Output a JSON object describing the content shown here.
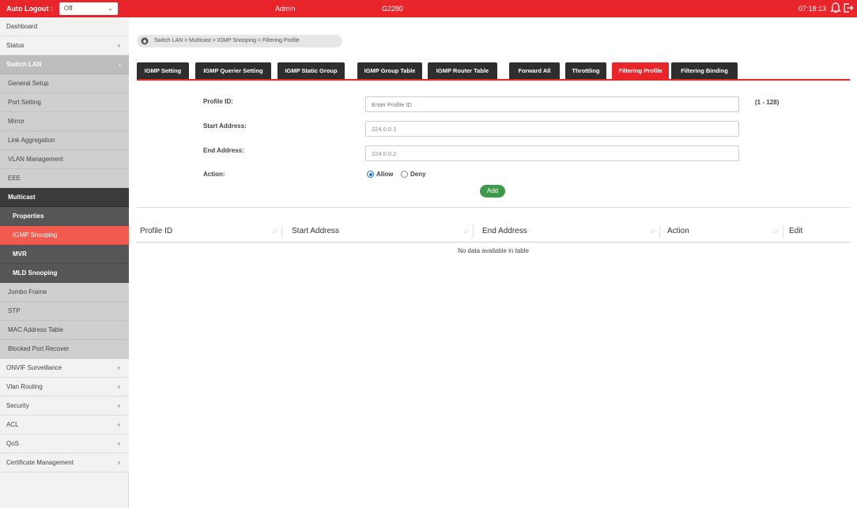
{
  "topbar": {
    "logout_label": "Auto Logout :",
    "logout_value": "Off",
    "user": "Admin",
    "model": "G2280",
    "clock": "07:18:13",
    "bell_icon": "bell-icon",
    "logout_icon": "logout-icon",
    "accent": "#e8252b"
  },
  "sidebar": {
    "items": [
      {
        "label": "Dashboard"
      },
      {
        "label": "Status",
        "sign": "+"
      },
      {
        "label": "Switch LAN",
        "sign": "-"
      },
      {
        "label": "General Setup"
      },
      {
        "label": "Port Setting"
      },
      {
        "label": "Mirror"
      },
      {
        "label": "Link Aggregation"
      },
      {
        "label": "VLAN Management"
      },
      {
        "label": "EEE"
      },
      {
        "label": "Multicast"
      },
      {
        "label": "Properties"
      },
      {
        "label": "IGMP Snooping"
      },
      {
        "label": "MVR"
      },
      {
        "label": "MLD Snooping"
      },
      {
        "label": "Jumbo Frame"
      },
      {
        "label": "STP"
      },
      {
        "label": "MAC Address Table"
      },
      {
        "label": "Blocked Port Recover"
      },
      {
        "label": "ONVIF Surveillance",
        "sign": "+"
      },
      {
        "label": "Vlan Routing",
        "sign": "+"
      },
      {
        "label": "Security",
        "sign": "+"
      },
      {
        "label": "ACL",
        "sign": "+"
      },
      {
        "label": "QoS",
        "sign": "+"
      },
      {
        "label": "Certificate Management",
        "sign": "+"
      }
    ]
  },
  "breadcrumb": "Switch LAN > Multicast > IGMP Snooping > Filtering Profile",
  "tabs": [
    {
      "label": "IGMP Setting"
    },
    {
      "label": "IGMP Querier Setting"
    },
    {
      "label": "IGMP Static Group"
    },
    {
      "label": "IGMP Group Table"
    },
    {
      "label": "IGMP Router Table"
    },
    {
      "label": "Forward All"
    },
    {
      "label": "Throttling"
    },
    {
      "label": "Filtering Profile"
    },
    {
      "label": "Filtering Binding"
    }
  ],
  "form": {
    "profile_id_label": "Profile ID:",
    "profile_id_placeholder": "Enter Profile ID",
    "profile_id_range": "(1 - 128)",
    "start_label": "Start Address:",
    "start_value": "224.0.0.1",
    "end_label": "End Address:",
    "end_value": "224.0.0.2",
    "action_label": "Action:",
    "allow_label": "Allow",
    "deny_label": "Deny",
    "selected_action": "Allow",
    "add_label": "Add"
  },
  "table": {
    "columns": [
      "Profile ID",
      "Start Address",
      "End Address",
      "Action",
      "Edit"
    ],
    "sort_glyph": "↓↑",
    "empty_text": "No data available in table"
  }
}
